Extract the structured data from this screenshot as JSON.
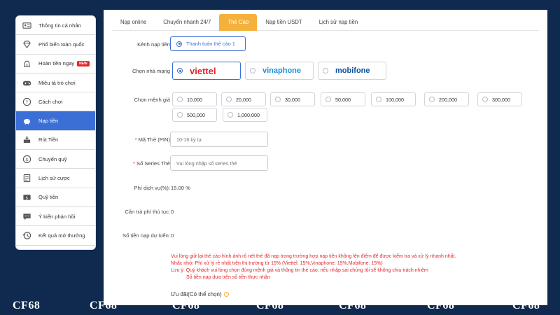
{
  "sidebar": {
    "items": [
      {
        "label": "Thông tin cá nhân",
        "icon": "id-card-icon"
      },
      {
        "label": "Phổ biến toàn quốc",
        "icon": "diamond-icon"
      },
      {
        "label": "Hoàn tiền ngay",
        "icon": "refund-bag-icon",
        "badge": "NEW"
      },
      {
        "label": "Miêu tả trò chơi",
        "icon": "gamepad-icon"
      },
      {
        "label": "Cách chơi",
        "icon": "help-icon"
      },
      {
        "label": "Nạp tiền",
        "icon": "piggy-bank-icon",
        "active": true
      },
      {
        "label": "Rút Tiền",
        "icon": "withdraw-icon"
      },
      {
        "label": "Chuyển quỹ",
        "icon": "transfer-coin-icon"
      },
      {
        "label": "Lịch sử cược",
        "icon": "bet-history-icon"
      },
      {
        "label": "Quỹ tiền",
        "icon": "fund-icon"
      },
      {
        "label": "Ý kiến phản hồi",
        "icon": "feedback-icon"
      },
      {
        "label": "Kết quả mở thưởng",
        "icon": "history-clock-icon"
      }
    ]
  },
  "tabs": [
    {
      "label": "Nạp online"
    },
    {
      "label": "Chuyển nhanh 24/7"
    },
    {
      "label": "Thẻ Cào",
      "active": true
    },
    {
      "label": "Nạp tiền USDT"
    },
    {
      "label": "Lịch sử nạp tiền"
    }
  ],
  "form": {
    "channel_label": "Kênh nạp tiền",
    "channel_value": "Thanh toán thẻ cào 1",
    "carrier_label": "Chọn nhà mạng",
    "carriers": [
      {
        "name": "viettel",
        "color": "#e4262d"
      },
      {
        "name": "vinaphone",
        "color": "#1d8fd6"
      },
      {
        "name": "mobifone",
        "color": "#0a4fa0"
      }
    ],
    "amount_label": "Chọn mệnh giá",
    "amounts": [
      "10,000",
      "20,000",
      "30,000",
      "50,000",
      "100,000",
      "200,000",
      "300,000",
      "500,000",
      "1,000,000"
    ],
    "pin_label": "Mã Thẻ (PIN)",
    "pin_placeholder": "10-16 ký tự",
    "serial_label": "Số Series Thẻ",
    "serial_placeholder": "Vui lòng nhập số series thẻ",
    "fee_label": "Phí dịch vụ(%):",
    "fee_value": "15.00 %",
    "fee_pay_label": "Cần trả phí thủ tục:",
    "fee_pay_value": "0",
    "expected_label": "Số tiền nạp dự kiến:",
    "expected_value": "0"
  },
  "notes": {
    "line1": "Vui lòng giữ lại thẻ cào hình ảnh rõ nét thẻ đã nạp trong trường hợp nạp tiền không lên điểm để được kiểm tra và xử lý nhanh nhất.",
    "line2": "Nhắc nhở: Phí xử lý rẻ nhất trên thị trường từ 15% (Viettel: 15%,Vinaphone: 15%,Mobifone: 15%)",
    "line3": "Lưu ý: Quý khách vui lòng chọn đúng mệnh giá và thông tin thẻ cào, nếu nhập sai chúng tôi sẽ không chịu trách nhiệm",
    "line4": "Số tiền nạp dựa trên số tiền thực nhận"
  },
  "offer_label": "Ưu đãi(Có thể chọn)",
  "watermark": "CF68",
  "colors": {
    "accent": "#3c6fd6",
    "tab_active": "#f4b13c",
    "warning": "#e4262d",
    "background": "#0f2a4e"
  }
}
